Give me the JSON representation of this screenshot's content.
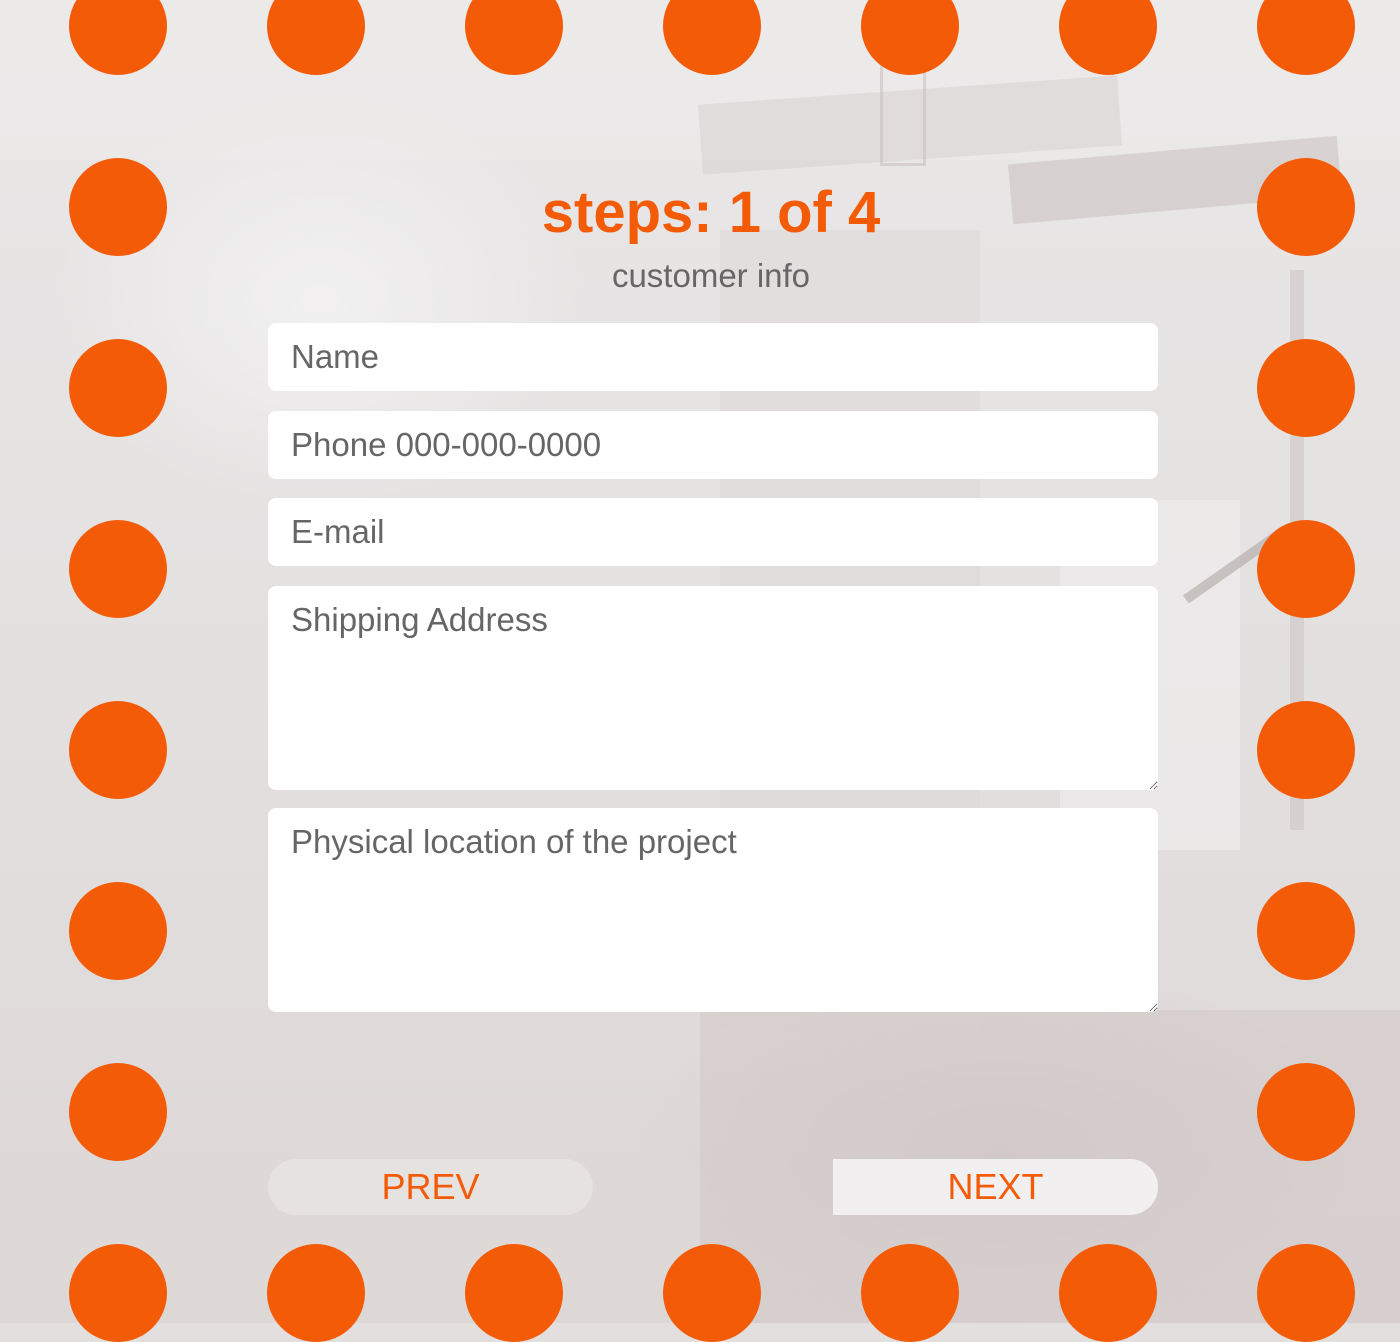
{
  "header": {
    "title": "steps: 1 of 4",
    "subtitle": "customer info"
  },
  "form": {
    "name_placeholder": "Name",
    "phone_placeholder": "Phone 000-000-0000",
    "email_placeholder": "E-mail",
    "shipping_placeholder": "Shipping Address",
    "location_placeholder": "Physical location of the project"
  },
  "nav": {
    "prev_label": "PREV",
    "next_label": "NEXT"
  },
  "colors": {
    "accent": "#f45b07",
    "text_gray": "#666666"
  }
}
